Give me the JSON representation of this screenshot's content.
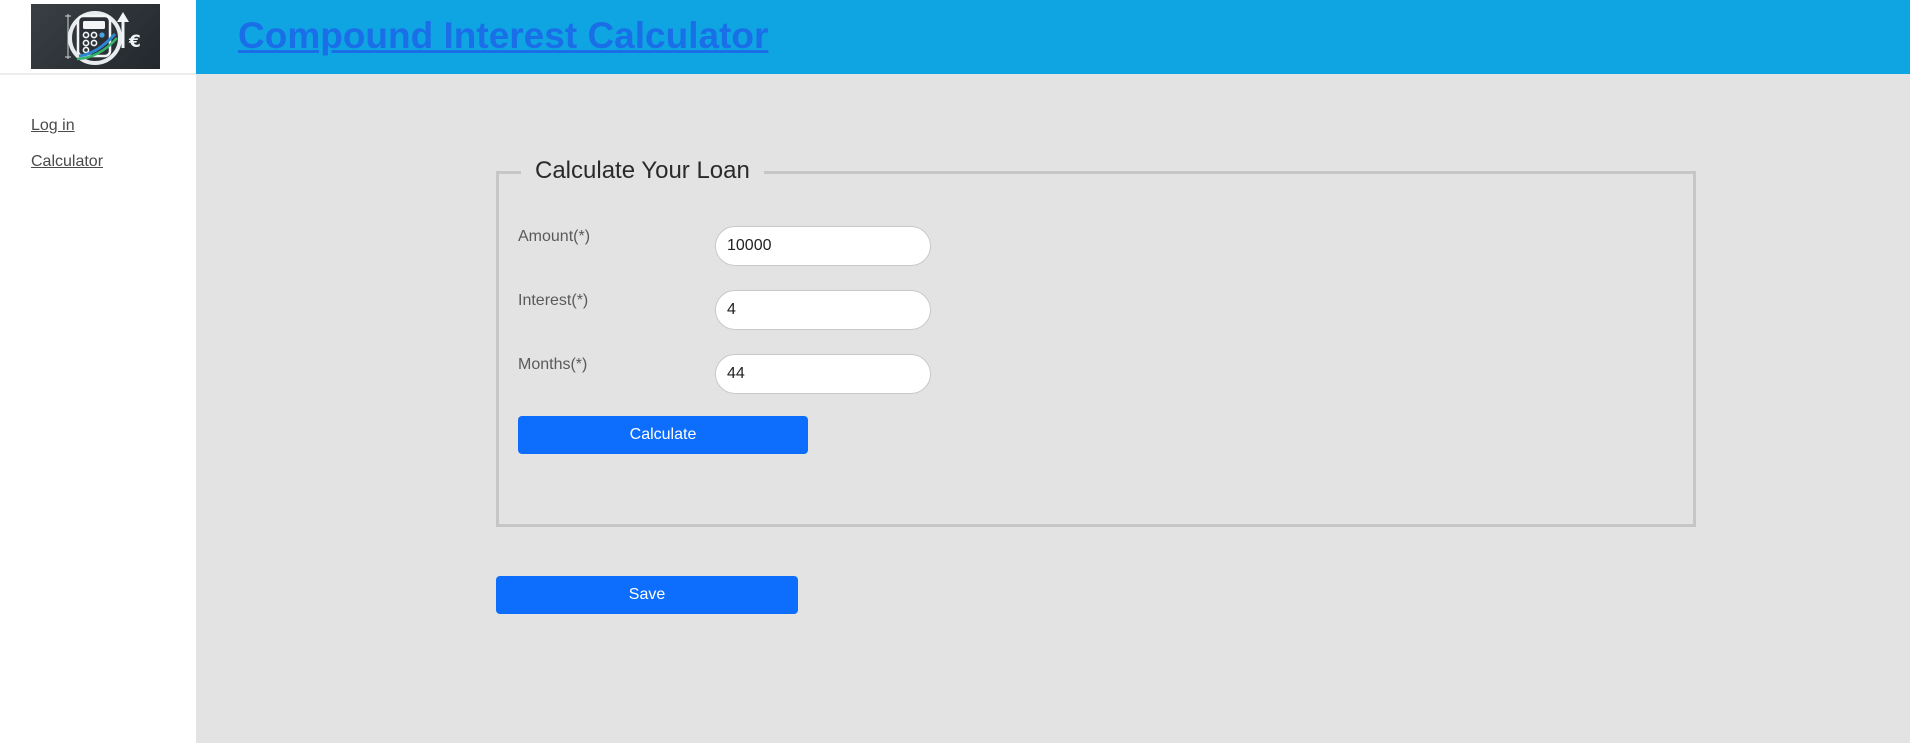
{
  "logo": {
    "icon": "calculator-growth-euro-logo",
    "symbol": "€"
  },
  "sidebar": {
    "links": [
      {
        "label": "Log in"
      },
      {
        "label": "Calculator"
      }
    ]
  },
  "header": {
    "title": "Compound Interest Calculator"
  },
  "form": {
    "legend": "Calculate Your Loan",
    "fields": [
      {
        "label": "Amount(*)",
        "value": "10000"
      },
      {
        "label": "Interest(*)",
        "value": "4"
      },
      {
        "label": "Months(*)",
        "value": "44"
      }
    ],
    "calculate_label": "Calculate"
  },
  "save_label": "Save",
  "colors": {
    "header_bg": "#0fa5e2",
    "title": "#1a6fe8",
    "button": "#0d6efd",
    "main_bg": "#e3e3e3"
  }
}
